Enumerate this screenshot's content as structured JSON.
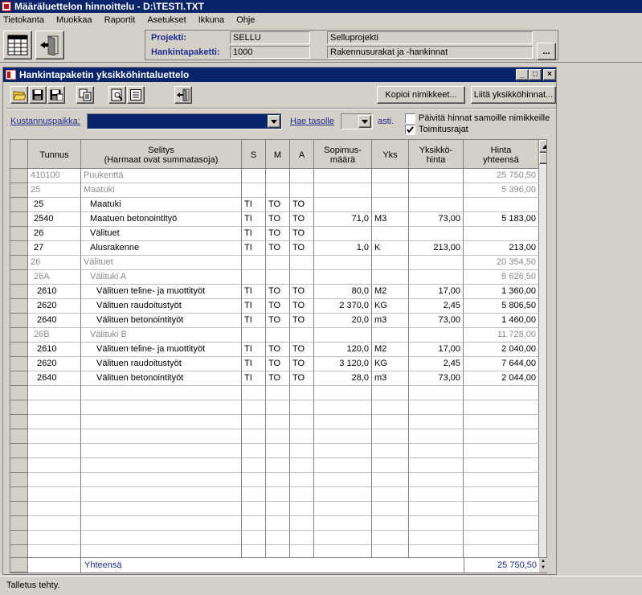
{
  "app": {
    "title": "Määräluettelon hinnoittelu - D:\\TESTI.TXT",
    "menu": [
      "Tietokanta",
      "Muokkaa",
      "Raportit",
      "Asetukset",
      "Ikkuna",
      "Ohje"
    ]
  },
  "project": {
    "project_label": "Projekti:",
    "project_code": "SELLU",
    "project_name": "Selluprojekti",
    "package_label": "Hankintapaketti:",
    "package_code": "1000",
    "package_name": "Rakennusurakat ja -hankinnat",
    "browse_label": "..."
  },
  "window": {
    "title": "Hankintapaketin  yksikköhintaluettelo",
    "copy_items_label": "Kopioi nimikkeet...",
    "attach_prices_label": "Liitä yksikköhinnat...",
    "cost_center_label": "Kustannuspaikka:",
    "cost_center_value": "",
    "fetch_level_label": "Hae tasolle",
    "fetch_level_value": "",
    "asti_label": "asti.",
    "update_prices_label": "Päivitä hinnat samoille nimikkeille",
    "update_prices_checked": false,
    "delivery_limits_label": "Toimitusrajat",
    "delivery_limits_checked": true
  },
  "table": {
    "headers": {
      "tunnus": "Tunnus",
      "selitys1": "Selitys",
      "selitys2": "(Harmaat ovat summatasoja)",
      "s": "S",
      "m": "M",
      "a": "A",
      "maara1": "Sopimus-",
      "maara2": "määrä",
      "yks": "Yks",
      "yh1": "Yksikkö-",
      "yh2": "hinta",
      "ht1": "Hinta",
      "ht2": "yhteensä"
    },
    "rows": [
      {
        "tunnus": "410100",
        "selitys": "Puukenttä",
        "s": "",
        "m": "",
        "a": "",
        "maara": "",
        "yks": "",
        "yh": "",
        "ht": "25 750,50",
        "sum": true,
        "ind": 0
      },
      {
        "tunnus": "25",
        "selitys": "Maatuki",
        "s": "",
        "m": "",
        "a": "",
        "maara": "",
        "yks": "",
        "yh": "",
        "ht": "5 396,00",
        "sum": true,
        "ind": 0
      },
      {
        "tunnus": "25",
        "selitys": "Maatuki",
        "s": "TI",
        "m": "TO",
        "a": "TO",
        "maara": "",
        "yks": "",
        "yh": "",
        "ht": "",
        "sum": false,
        "ind": 1
      },
      {
        "tunnus": "2540",
        "selitys": "Maatuen betonointityö",
        "s": "TI",
        "m": "TO",
        "a": "TO",
        "maara": "71,0",
        "yks": "M3",
        "yh": "73,00",
        "ht": "5 183,00",
        "sum": false,
        "ind": 1
      },
      {
        "tunnus": "26",
        "selitys": "Välituet",
        "s": "TI",
        "m": "TO",
        "a": "TO",
        "maara": "",
        "yks": "",
        "yh": "",
        "ht": "",
        "sum": false,
        "ind": 1
      },
      {
        "tunnus": "27",
        "selitys": "Alusrakenne",
        "s": "TI",
        "m": "TO",
        "a": "TO",
        "maara": "1,0",
        "yks": "K",
        "yh": "213,00",
        "ht": "213,00",
        "sum": false,
        "ind": 1
      },
      {
        "tunnus": "26",
        "selitys": "Välituet",
        "s": "",
        "m": "",
        "a": "",
        "maara": "",
        "yks": "",
        "yh": "",
        "ht": "20 354,50",
        "sum": true,
        "ind": 0
      },
      {
        "tunnus": "26A",
        "selitys": "Välituki A",
        "s": "",
        "m": "",
        "a": "",
        "maara": "",
        "yks": "",
        "yh": "",
        "ht": "8 626,50",
        "sum": true,
        "ind": 1
      },
      {
        "tunnus": "2610",
        "selitys": "Välituen teline- ja muottityöt",
        "s": "TI",
        "m": "TO",
        "a": "TO",
        "maara": "80,0",
        "yks": "M2",
        "yh": "17,00",
        "ht": "1 360,00",
        "sum": false,
        "ind": 2
      },
      {
        "tunnus": "2620",
        "selitys": "Välituen raudoitustyöt",
        "s": "TI",
        "m": "TO",
        "a": "TO",
        "maara": "2 370,0",
        "yks": "KG",
        "yh": "2,45",
        "ht": "5 806,50",
        "sum": false,
        "ind": 2
      },
      {
        "tunnus": "2640",
        "selitys": "Välituen betonointityöt",
        "s": "TI",
        "m": "TO",
        "a": "TO",
        "maara": "20,0",
        "yks": "m3",
        "yh": "73,00",
        "ht": "1 460,00",
        "sum": false,
        "ind": 2
      },
      {
        "tunnus": "26B",
        "selitys": "Välituki B",
        "s": "",
        "m": "",
        "a": "",
        "maara": "",
        "yks": "",
        "yh": "",
        "ht": "11 728,00",
        "sum": true,
        "ind": 1
      },
      {
        "tunnus": "2610",
        "selitys": "Välituen teline- ja muottityöt",
        "s": "TI",
        "m": "TO",
        "a": "TO",
        "maara": "120,0",
        "yks": "M2",
        "yh": "17,00",
        "ht": "2 040,00",
        "sum": false,
        "ind": 2
      },
      {
        "tunnus": "2620",
        "selitys": "Välituen raudoitustyöt",
        "s": "TI",
        "m": "TO",
        "a": "TO",
        "maara": "3 120,0",
        "yks": "KG",
        "yh": "2,45",
        "ht": "7 644,00",
        "sum": false,
        "ind": 2
      },
      {
        "tunnus": "2640",
        "selitys": "Välituen betonointityöt",
        "s": "TI",
        "m": "TO",
        "a": "TO",
        "maara": "28,0",
        "yks": "m3",
        "yh": "73,00",
        "ht": "2 044,00",
        "sum": false,
        "ind": 2
      }
    ],
    "empty_rows": 13,
    "total_label": "Yhteensä",
    "total_value": "25 750,50"
  },
  "status": {
    "text": "Talletus tehty."
  },
  "icons": {
    "app": "app-icon",
    "grid": "grid-icon",
    "exit": "exit-door-icon",
    "open": "open-folder-icon",
    "save": "save-disk-icon",
    "save_as": "save-as-disk-icon",
    "copy": "copy-icon",
    "preview": "print-preview-icon",
    "list": "list-icon",
    "close_window": "exit-door-icon"
  },
  "colors": {
    "titlebar": "#08246b",
    "label_blue": "#1f2d8c",
    "sum_row_text": "#8c8c8c",
    "cost_center_fill": "#08246b"
  }
}
